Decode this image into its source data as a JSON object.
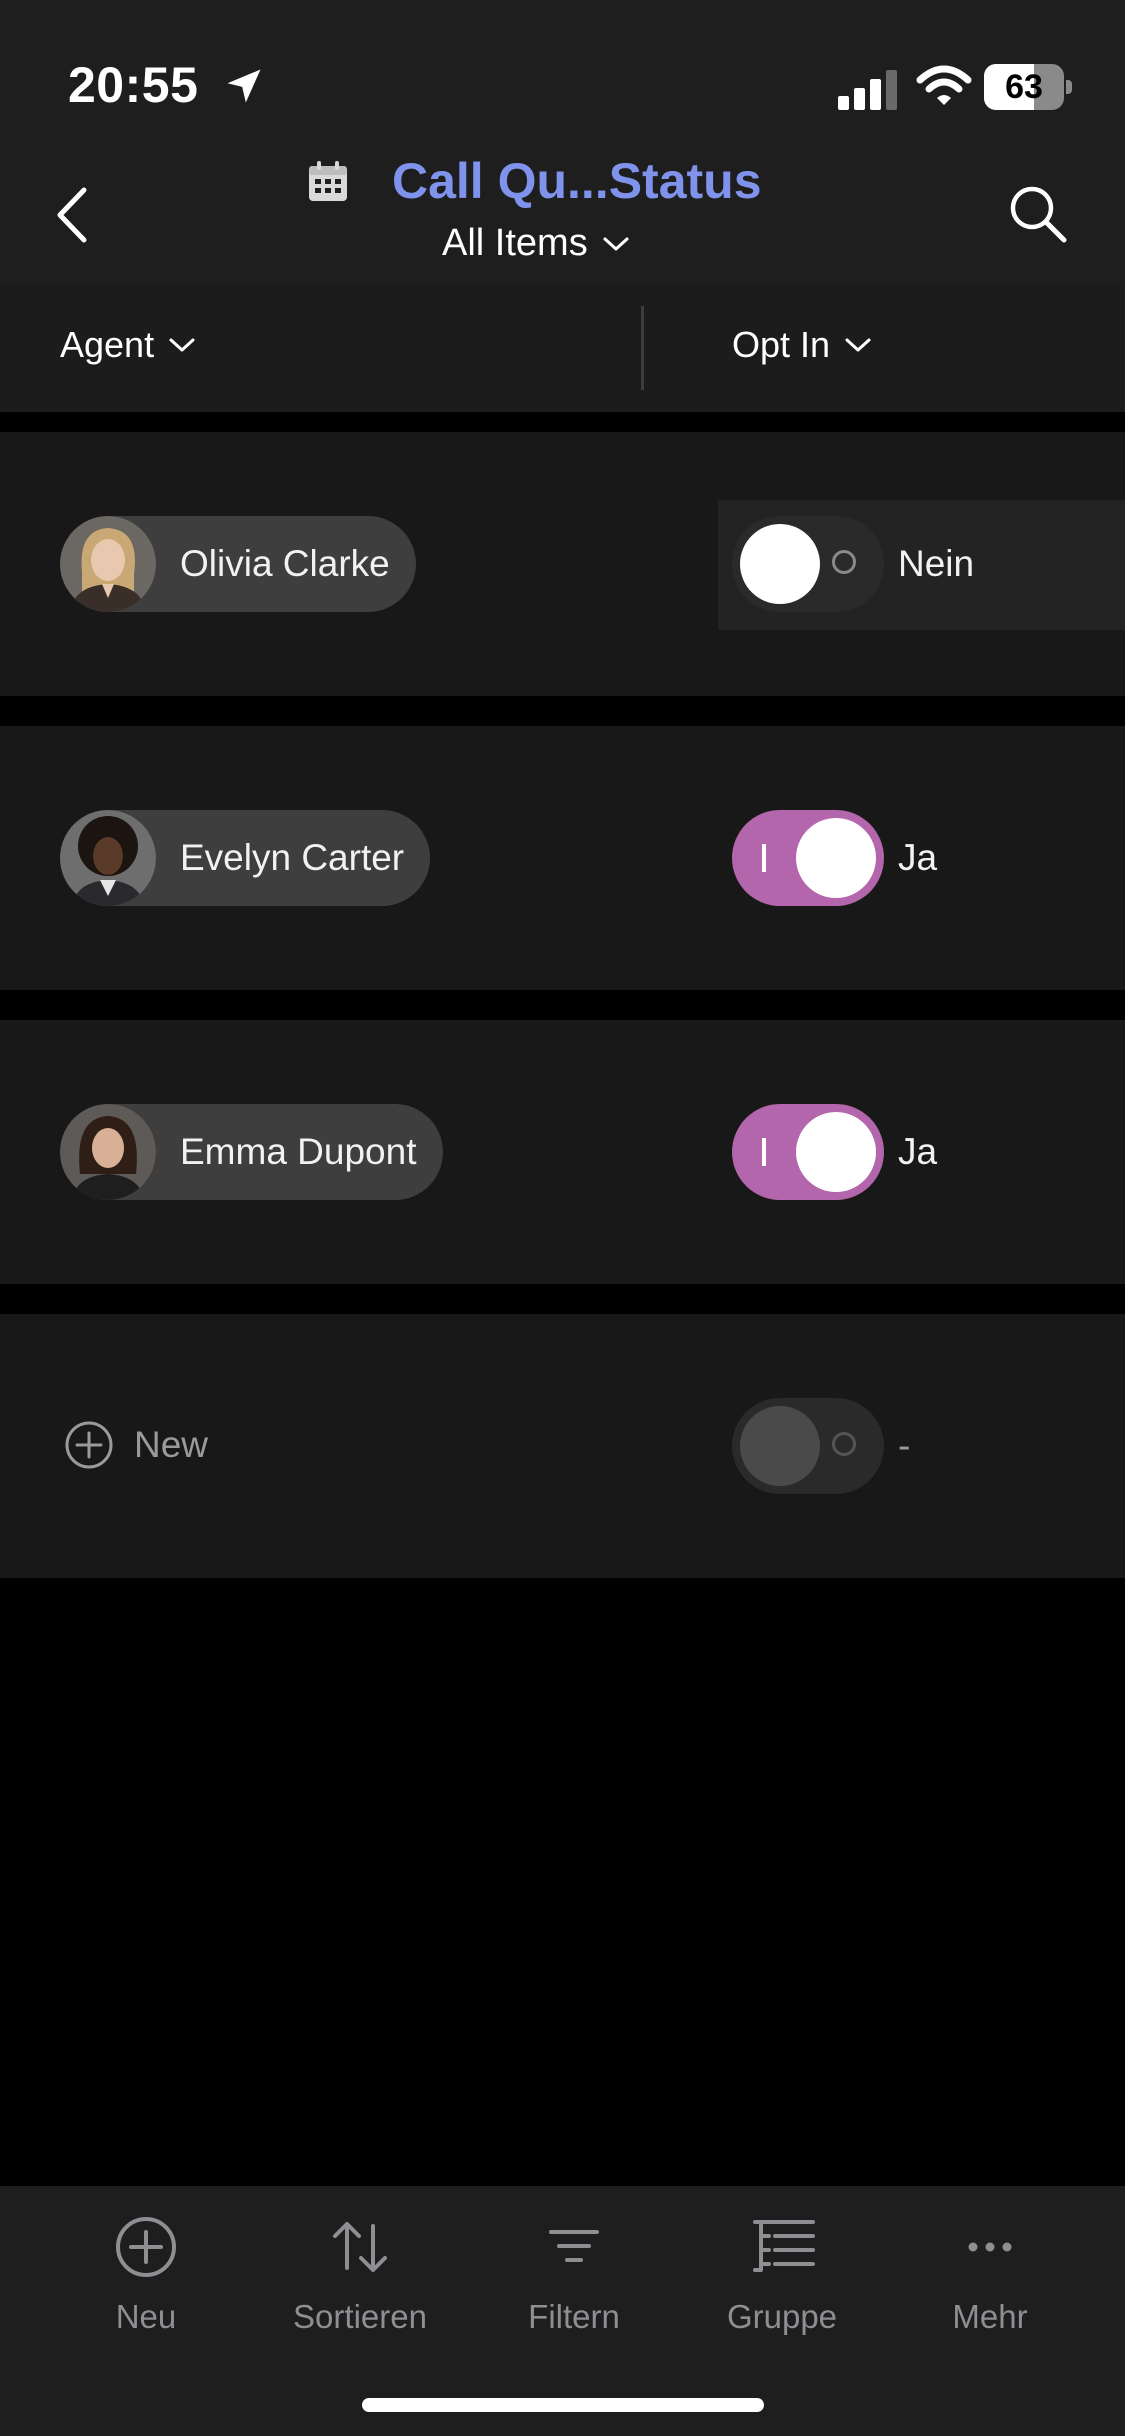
{
  "status_bar": {
    "time": "20:55",
    "battery_level": "63",
    "battery_fraction": 0.63
  },
  "header": {
    "title": "Call Qu...Status",
    "view": "All Items",
    "title_color": "#7f93ec"
  },
  "columns": {
    "agent": "Agent",
    "opt_in": "Opt In"
  },
  "rows": [
    {
      "name": "Olivia Clarke",
      "opt_in": false,
      "opt_label": "Nein"
    },
    {
      "name": "Evelyn Carter",
      "opt_in": true,
      "opt_label": "Ja"
    },
    {
      "name": "Emma Dupont",
      "opt_in": true,
      "opt_label": "Ja"
    }
  ],
  "new_row": {
    "label": "New",
    "opt_label": "-"
  },
  "toolbar": {
    "new": "Neu",
    "sort": "Sortieren",
    "filter": "Filtern",
    "group": "Gruppe",
    "more": "Mehr"
  },
  "colors": {
    "toggle_on": "#b366ab",
    "background": "#000000",
    "row": "#181818"
  },
  "icons": [
    "location-arrow-icon",
    "signal-icon",
    "wifi-icon",
    "battery-icon",
    "back-chevron-icon",
    "calendar-icon",
    "search-icon",
    "chevron-down-icon",
    "plus-circle-icon",
    "sort-arrows-icon",
    "filter-icon",
    "group-list-icon",
    "more-dots-icon"
  ]
}
